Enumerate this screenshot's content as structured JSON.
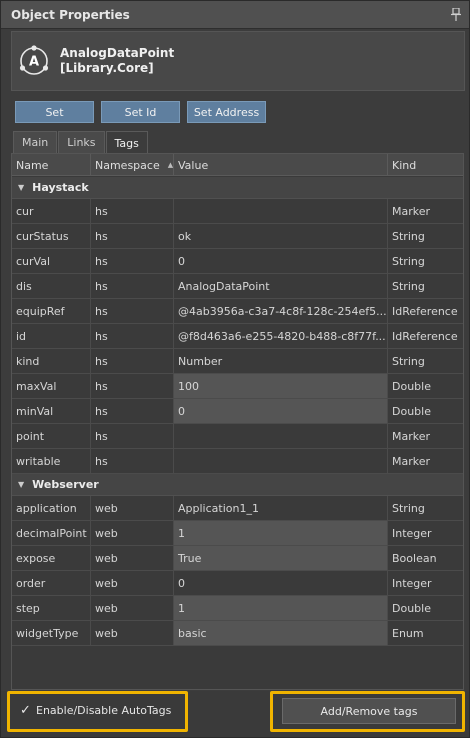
{
  "panel": {
    "title": "Object Properties"
  },
  "object": {
    "name_line1": "AnalogDataPoint",
    "name_line2": "[Library.Core]"
  },
  "buttons": {
    "set": "Set",
    "set_id": "Set Id",
    "set_address": "Set Address"
  },
  "tabs": [
    {
      "label": "Main"
    },
    {
      "label": "Links"
    },
    {
      "label": "Tags",
      "active": true
    }
  ],
  "columns": {
    "name": "Name",
    "namespace": "Namespace",
    "value": "Value",
    "kind": "Kind"
  },
  "groups": [
    {
      "label": "Haystack",
      "rows": [
        {
          "name": "cur",
          "ns": "hs",
          "value": "",
          "kind": "Marker",
          "editable": false
        },
        {
          "name": "curStatus",
          "ns": "hs",
          "value": "ok",
          "kind": "String",
          "editable": false
        },
        {
          "name": "curVal",
          "ns": "hs",
          "value": "0",
          "kind": "String",
          "editable": false
        },
        {
          "name": "dis",
          "ns": "hs",
          "value": "AnalogDataPoint",
          "kind": "String",
          "editable": false
        },
        {
          "name": "equipRef",
          "ns": "hs",
          "value": "@4ab3956a-c3a7-4c8f-128c-254ef5...",
          "kind": "IdReference",
          "editable": false
        },
        {
          "name": "id",
          "ns": "hs",
          "value": "@f8d463a6-e255-4820-b488-c8f77f...",
          "kind": "IdReference",
          "editable": false
        },
        {
          "name": "kind",
          "ns": "hs",
          "value": "Number",
          "kind": "String",
          "editable": false
        },
        {
          "name": "maxVal",
          "ns": "hs",
          "value": "100",
          "kind": "Double",
          "editable": true
        },
        {
          "name": "minVal",
          "ns": "hs",
          "value": "0",
          "kind": "Double",
          "editable": true
        },
        {
          "name": "point",
          "ns": "hs",
          "value": "",
          "kind": "Marker",
          "editable": false
        },
        {
          "name": "writable",
          "ns": "hs",
          "value": "",
          "kind": "Marker",
          "editable": false
        }
      ]
    },
    {
      "label": "Webserver",
      "rows": [
        {
          "name": "application",
          "ns": "web",
          "value": "Application1_1",
          "kind": "String",
          "editable": false
        },
        {
          "name": "decimalPoint",
          "ns": "web",
          "value": "1",
          "kind": "Integer",
          "editable": true
        },
        {
          "name": "expose",
          "ns": "web",
          "value": "True",
          "kind": "Boolean",
          "editable": true
        },
        {
          "name": "order",
          "ns": "web",
          "value": "0",
          "kind": "Integer",
          "editable": false
        },
        {
          "name": "step",
          "ns": "web",
          "value": "1",
          "kind": "Double",
          "editable": true
        },
        {
          "name": "widgetType",
          "ns": "web",
          "value": "basic",
          "kind": "Enum",
          "editable": true
        }
      ]
    }
  ],
  "footer": {
    "autotags_label": "Enable/Disable AutoTags",
    "autotags_checked": true,
    "add_remove_label": "Add/Remove tags",
    "highlight_color": "#f0b400"
  },
  "colors": {
    "button_blue": "#5f7f9f",
    "panel_bg": "#3c3c3c",
    "title_bg": "#505050"
  }
}
